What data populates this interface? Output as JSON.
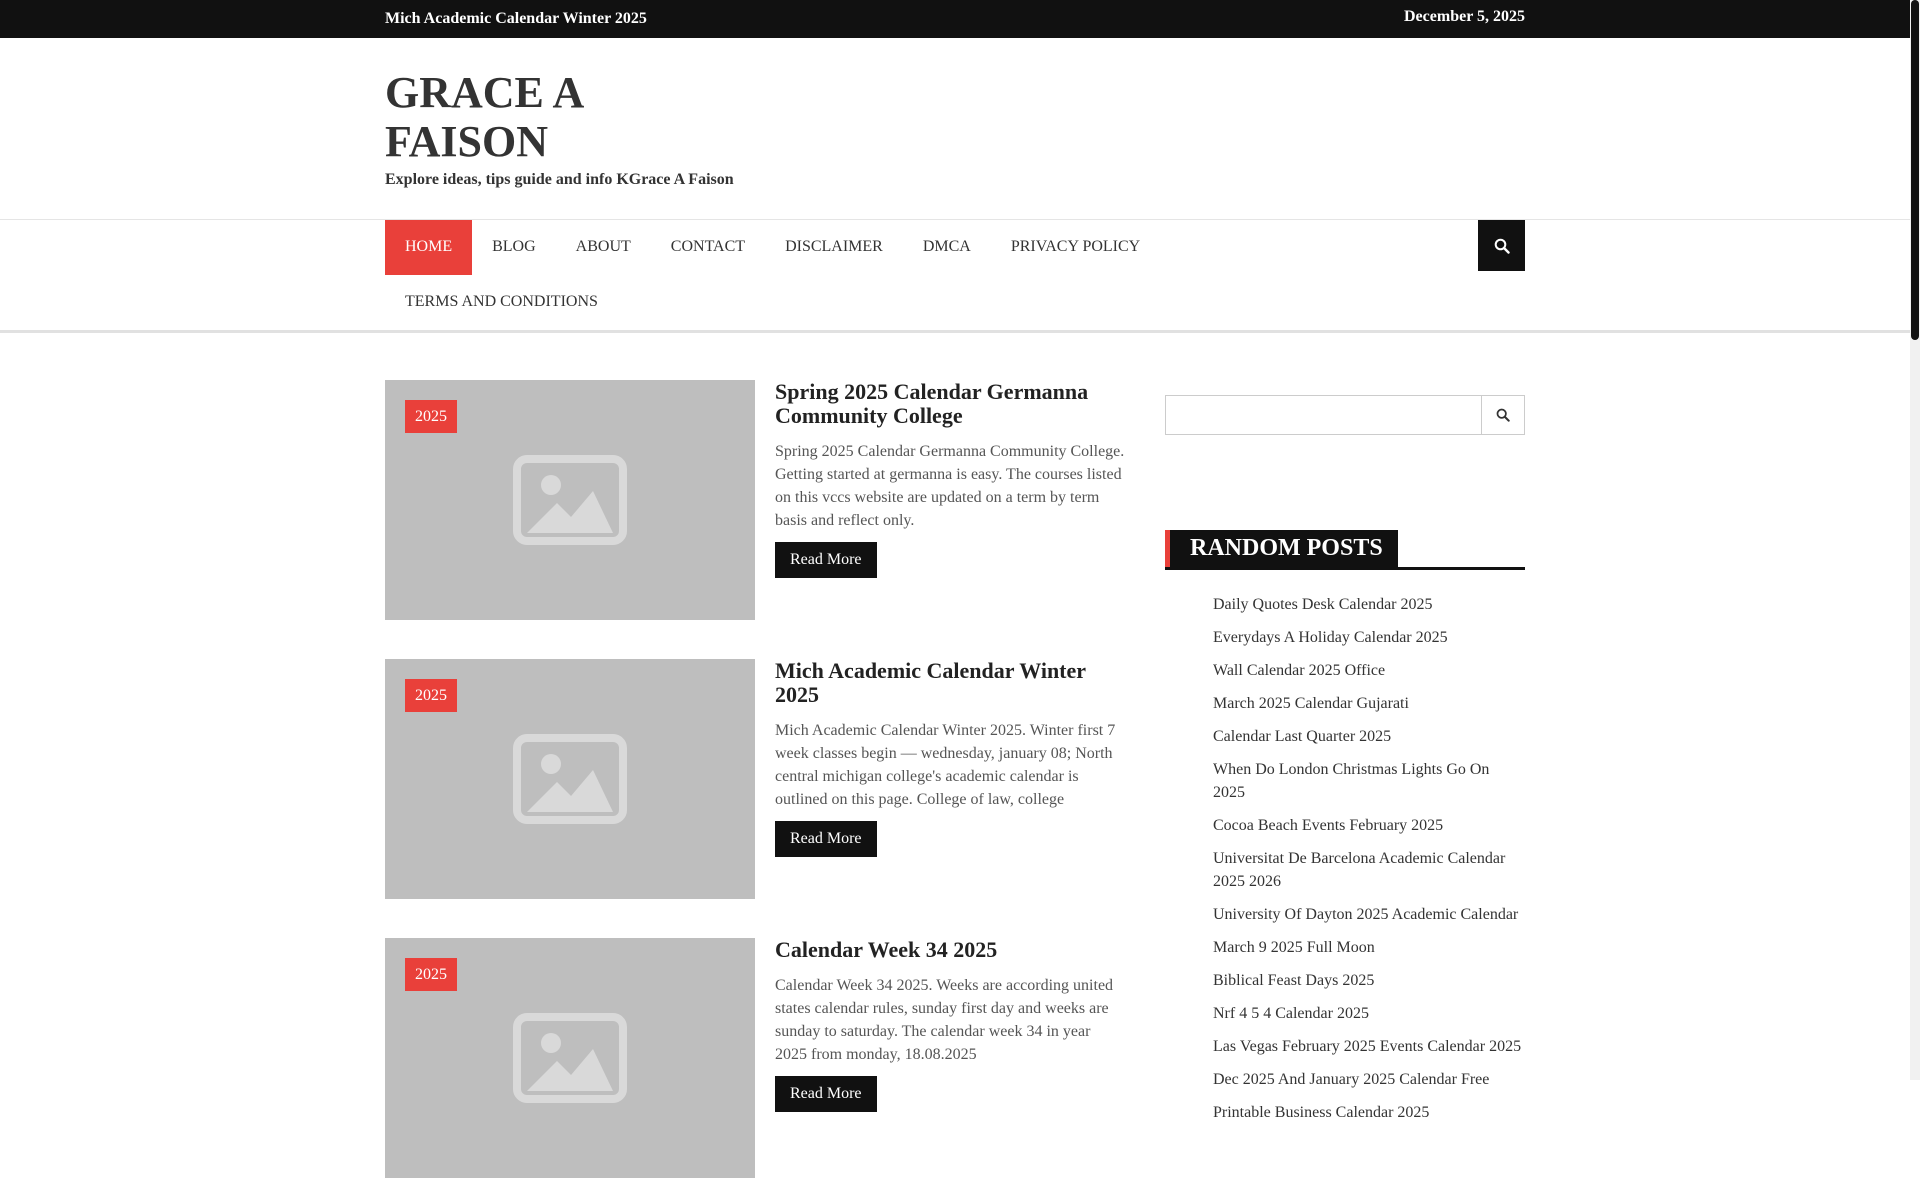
{
  "topbar": {
    "ticker": "Mich Academic Calendar Winter 2025",
    "date": "December 5, 2025"
  },
  "site": {
    "title": "GRACE A FAISON",
    "description": "Explore ideas, tips guide and info KGrace A Faison"
  },
  "nav": {
    "items": [
      {
        "label": "HOME"
      },
      {
        "label": "BLOG"
      },
      {
        "label": "ABOUT"
      },
      {
        "label": "CONTACT"
      },
      {
        "label": "DISCLAIMER"
      },
      {
        "label": "DMCA"
      },
      {
        "label": "PRIVACY POLICY"
      },
      {
        "label": "TERMS AND CONDITIONS"
      }
    ]
  },
  "posts": [
    {
      "badge": "2025",
      "title": "Spring 2025 Calendar Germanna Community College",
      "excerpt": "Spring 2025 Calendar Germanna Community College. Getting started at germanna is easy. The courses listed on this vccs website are updated on a term by term basis and reflect only.",
      "read_more": "Read More"
    },
    {
      "badge": "2025",
      "title": "Mich Academic Calendar Winter 2025",
      "excerpt": "Mich Academic Calendar Winter 2025. Winter first 7 week classes begin — wednesday, january 08; North central michigan college's academic calendar is outlined on this page. College of law, college",
      "read_more": "Read More"
    },
    {
      "badge": "2025",
      "title": "Calendar Week 34 2025",
      "excerpt": "Calendar Week 34 2025. Weeks are according united states calendar rules, sunday first day and weeks are sunday to saturday. The calendar week 34 in year 2025 from monday, 18.08.2025",
      "read_more": "Read More"
    }
  ],
  "sidebar": {
    "search_value": "",
    "random_posts_title": "RANDOM POSTS",
    "random_posts": [
      "Daily Quotes Desk Calendar 2025",
      "Everydays A Holiday Calendar 2025",
      "Wall Calendar 2025 Office",
      "March 2025 Calendar Gujarati",
      "Calendar Last Quarter 2025",
      "When Do London Christmas Lights Go On 2025",
      "Cocoa Beach Events February 2025",
      "Universitat De Barcelona Academic Calendar 2025 2026",
      "University Of Dayton 2025 Academic Calendar",
      "March 9 2025 Full Moon",
      "Biblical Feast Days 2025",
      "Nrf 4 5 4 Calendar 2025",
      "Las Vegas February 2025 Events Calendar 2025",
      "Dec 2025 And January 2025 Calendar Free",
      "Printable Business Calendar 2025"
    ]
  },
  "colors": {
    "accent": "#e9403a",
    "dark": "#111111",
    "thumb": "#bebebe"
  }
}
